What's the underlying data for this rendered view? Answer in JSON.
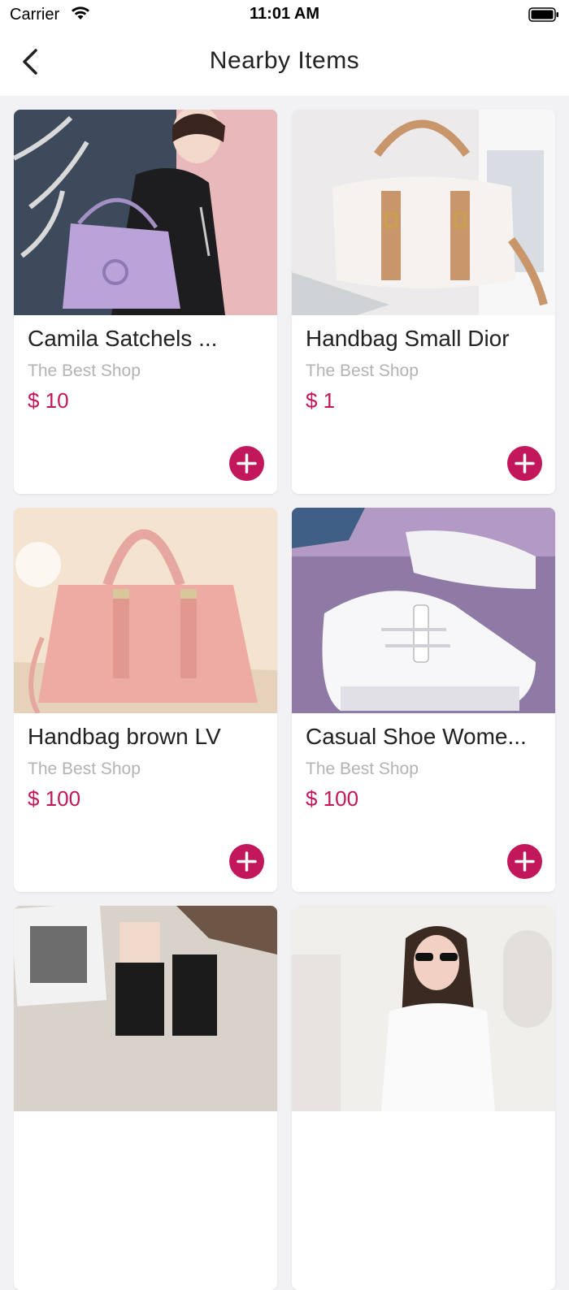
{
  "status_bar": {
    "carrier": "Carrier",
    "time": "11:01 AM"
  },
  "nav": {
    "title": "Nearby Items"
  },
  "colors": {
    "accent": "#c2185b",
    "muted_text": "#b3b3b3"
  },
  "items": [
    {
      "name": "Camila Satchels ...",
      "shop": "The Best Shop",
      "price": "$ 10",
      "image": "purple-handbag-photo"
    },
    {
      "name": "Handbag Small Dior",
      "shop": "The Best Shop",
      "price": "$ 1",
      "image": "white-tan-handbag-photo"
    },
    {
      "name": "Handbag brown LV",
      "shop": "The Best Shop",
      "price": "$ 100",
      "image": "pink-handbag-photo"
    },
    {
      "name": "Casual Shoe Wome...",
      "shop": "The Best Shop",
      "price": "$ 100",
      "image": "white-sneaker-photo"
    },
    {
      "name": "",
      "shop": "",
      "price": "",
      "image": "socks-photo"
    },
    {
      "name": "",
      "shop": "",
      "price": "",
      "image": "woman-sunglasses-photo"
    }
  ]
}
